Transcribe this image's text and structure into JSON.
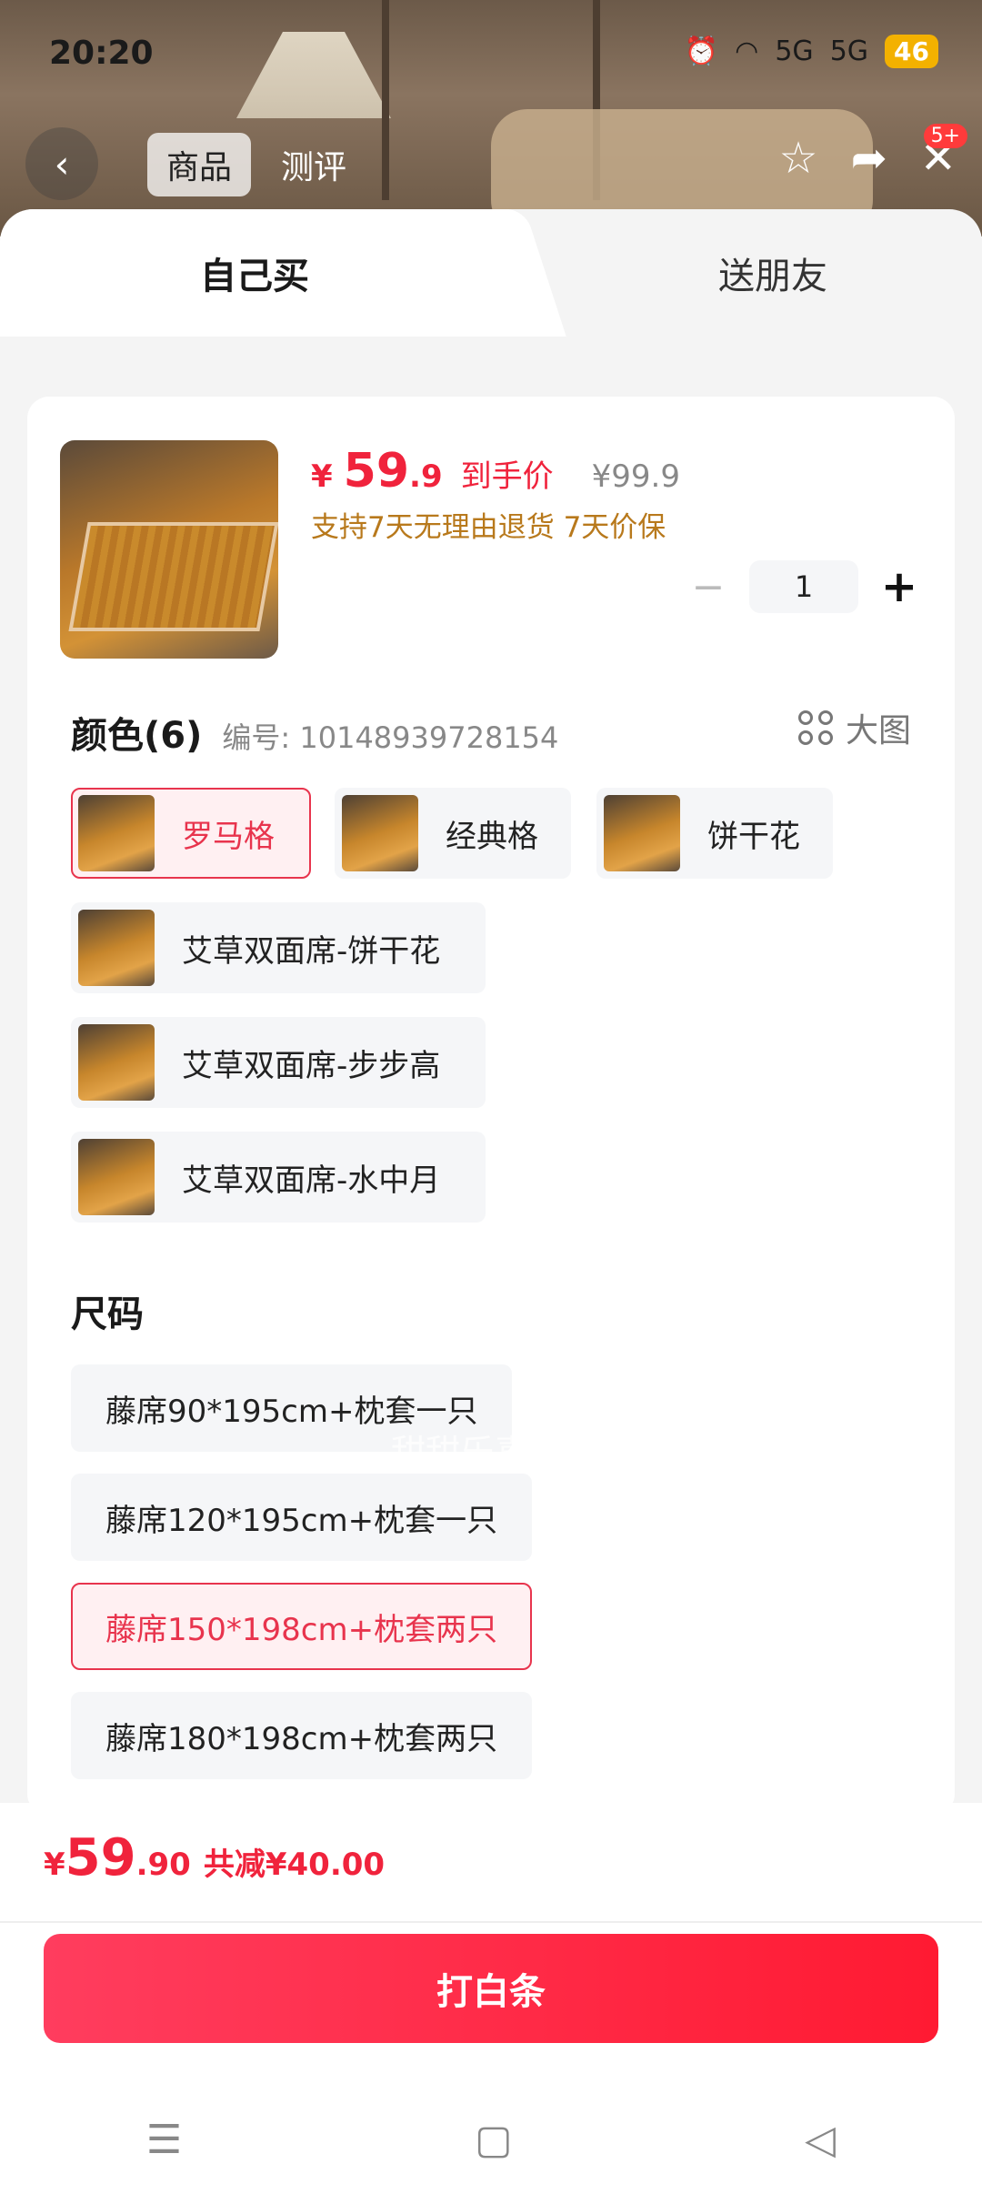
{
  "status": {
    "time": "20:20",
    "battery": "46",
    "signal1": "5G",
    "signal2": "5G"
  },
  "nav": {
    "tab_goods": "商品",
    "tab_review": "测评",
    "badge": "5+"
  },
  "sheet_tabs": {
    "self": "自己买",
    "friend": "送朋友"
  },
  "product": {
    "currency": "¥",
    "price_int": "59",
    "price_dec": ".9",
    "price_label": "到手价",
    "original_price": "¥99.9",
    "promise": "支持7天无理由退货 7天价保",
    "quantity": "1"
  },
  "color_section": {
    "title": "颜色(6)",
    "sku": "编号: 10148939728154",
    "big_image": "大图",
    "options": [
      {
        "label": "罗马格",
        "selected": true
      },
      {
        "label": "经典格",
        "selected": false
      },
      {
        "label": "饼干花",
        "selected": false
      },
      {
        "label": "艾草双面席-饼干花",
        "selected": false
      },
      {
        "label": "艾草双面席-步步高",
        "selected": false
      },
      {
        "label": "艾草双面席-水中月",
        "selected": false
      }
    ]
  },
  "size_section": {
    "title": "尺码",
    "options": [
      {
        "label": "藤席90*195cm+枕套一只",
        "selected": false
      },
      {
        "label": "藤席120*195cm+枕套一只",
        "selected": false
      },
      {
        "label": "藤席150*198cm+枕套两只",
        "selected": true
      },
      {
        "label": "藤席180*198cm+枕套两只",
        "selected": false
      }
    ]
  },
  "watermark": "甜甜乐喜片",
  "bottom": {
    "currency": "¥",
    "total_int": "59",
    "total_dec": ".90",
    "discount": "共减¥40.00",
    "cta": "打白条"
  },
  "colors": {
    "accent": "#f0233c",
    "gold": "#b8791c"
  }
}
